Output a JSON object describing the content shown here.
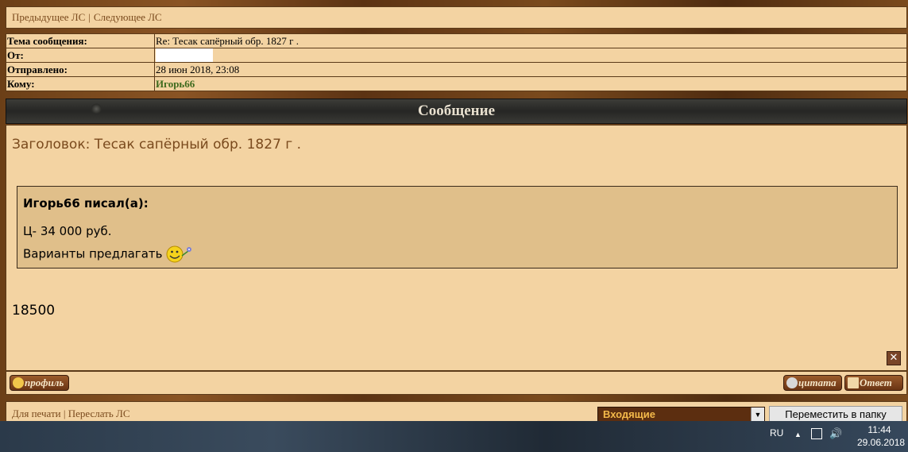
{
  "nav": {
    "prev": "Предыдущее ЛС",
    "separator": "|",
    "next": "Следующее ЛС"
  },
  "header": {
    "subject_label": "Тема сообщения:",
    "subject_value": "Re: Тесак сапёрный обр. 1827 г .",
    "from_label": "От:",
    "sent_label": "Отправлено:",
    "sent_value": "28 июн 2018, 23:08",
    "to_label": "Кому:",
    "to_value": "Игорь66"
  },
  "message": {
    "bar_title": "Сообщение",
    "subject_line": "Заголовок: Тесак сапёрный обр. 1827 г .",
    "quote": {
      "author": "Игорь66 писал(а):",
      "line1": "Ц- 34 000 руб.",
      "line2": "Варианты предлагать",
      "smiley_icon": "smiley-flower-icon"
    },
    "reply_text": "18500"
  },
  "buttons": {
    "profile": "профиль",
    "quote": "цитата",
    "reply": "Ответ",
    "close": "✕"
  },
  "footer": {
    "print": "Для печати",
    "separator": "|",
    "forward": "Переслать ЛС",
    "folder_selected": "Входящие",
    "move_button": "Переместить в папку"
  },
  "taskbar": {
    "lang": "RU",
    "time": "11:44",
    "date": "29.06.2018"
  },
  "colors": {
    "panel": "#f3d3a2",
    "text_brown": "#7a4a1d",
    "recipient": "#3f6b1e"
  }
}
